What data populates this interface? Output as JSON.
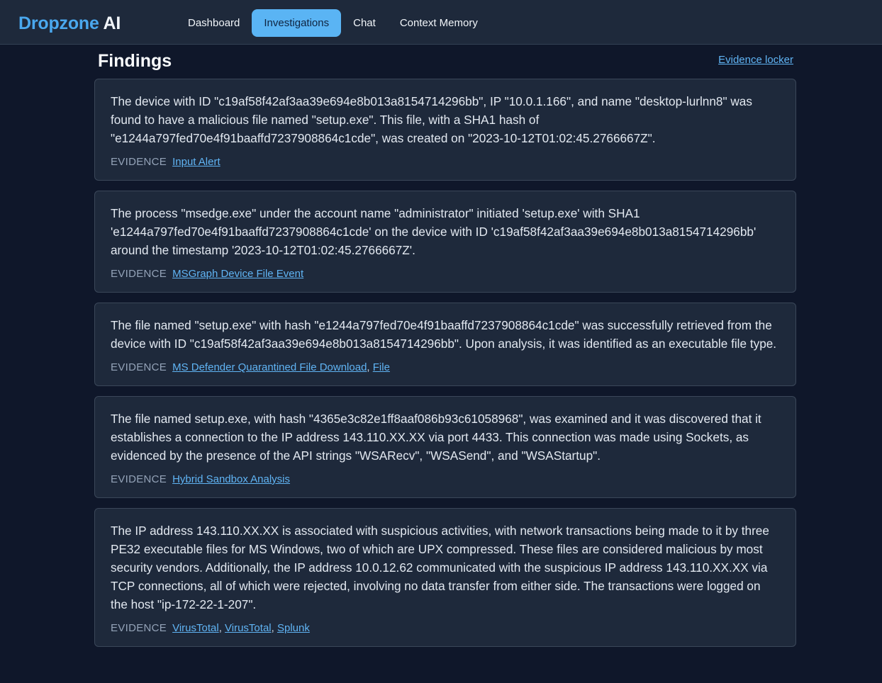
{
  "brand": {
    "part1": "Dropzone",
    "part2": " AI"
  },
  "nav": {
    "tabs": [
      {
        "label": "Dashboard",
        "active": false
      },
      {
        "label": "Investigations",
        "active": true
      },
      {
        "label": "Chat",
        "active": false
      },
      {
        "label": "Context Memory",
        "active": false
      }
    ]
  },
  "header": {
    "title": "Findings",
    "locker_link": "Evidence locker"
  },
  "evidence_label": "EVIDENCE",
  "findings": [
    {
      "text": "The device with ID \"c19af58f42af3aa39e694e8b013a8154714296bb\", IP \"10.0.1.166\", and name \"desktop-lurlnn8\" was found to have a malicious file named \"setup.exe\". This file, with a SHA1 hash of \"e1244a797fed70e4f91baaffd7237908864c1cde\", was created on \"2023-10-12T01:02:45.2766667Z\".",
      "evidence": [
        "Input Alert"
      ]
    },
    {
      "text": "The process \"msedge.exe\" under the account name \"administrator\" initiated 'setup.exe' with SHA1 'e1244a797fed70e4f91baaffd7237908864c1cde' on the device with ID 'c19af58f42af3aa39e694e8b013a8154714296bb' around the timestamp '2023-10-12T01:02:45.2766667Z'.",
      "evidence": [
        "MSGraph Device File Event"
      ]
    },
    {
      "text": "The file named \"setup.exe\" with hash \"e1244a797fed70e4f91baaffd7237908864c1cde\" was successfully retrieved from the device with ID \"c19af58f42af3aa39e694e8b013a8154714296bb\". Upon analysis, it was identified as an executable file type.",
      "evidence": [
        "MS Defender Quarantined File Download",
        "File"
      ]
    },
    {
      "text": "The file named setup.exe, with hash \"4365e3c82e1ff8aaf086b93c61058968\", was examined and it was discovered that it establishes a connection to the IP address 143.110.XX.XX via port 4433. This connection was made using Sockets, as evidenced by the presence of the API strings \"WSARecv\", \"WSASend\", and \"WSAStartup\".",
      "evidence": [
        "Hybrid Sandbox Analysis"
      ]
    },
    {
      "text": "The IP address 143.110.XX.XX is associated with suspicious activities, with network transactions being made to it by three PE32 executable files for MS Windows, two of which are UPX compressed. These files are considered malicious by most security vendors. Additionally, the IP address 10.0.12.62 communicated with the suspicious IP address 143.110.XX.XX via TCP connections, all of which were rejected, involving no data transfer from either side. The transactions were logged on the host \"ip-172-22-1-207\".",
      "evidence": [
        "VirusTotal",
        "VirusTotal",
        "Splunk"
      ]
    }
  ],
  "separator": ", "
}
